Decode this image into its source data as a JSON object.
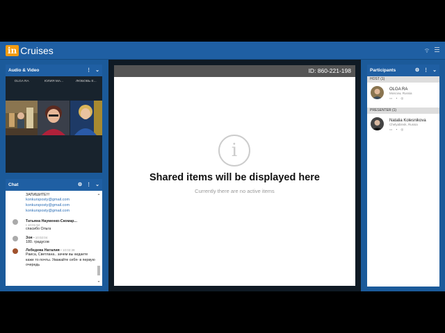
{
  "app": {
    "logo_in": "in",
    "logo_text": "Cruises"
  },
  "av_panel": {
    "title": "Audio & Video",
    "participants": [
      "OLGA RA",
      "ЮЛИЯ МА...",
      "ЛЮБОВЬ Е..."
    ]
  },
  "chat": {
    "title": "Chat",
    "top_text": "ЗАПИШИТЕ!!!",
    "links": [
      "konkursposty@gmail.com",
      "konkursposty@gmail.com",
      "konkursposty@gmail.com"
    ],
    "messages": [
      {
        "name": "Татьяна Науменко-Скомар...",
        "time": "• 10:01:52",
        "text": "спасибо Ольга"
      },
      {
        "name": "Зоя",
        "time": "• 10:02:04",
        "text": "180. градусов"
      },
      {
        "name": "Лебедева Наталия",
        "time": "• 10:02:38",
        "text": "Раиса, Светлана.. зачем вы кидаете каже то почты. Уважайте себя- в первую очередь"
      }
    ]
  },
  "center": {
    "meeting_id": "ID: 860-221-198",
    "title": "Shared items will be displayed here",
    "subtitle": "Currently there are no active items"
  },
  "participants": {
    "title": "Participants",
    "host_label": "HOST (1)",
    "presenter_label": "PRESENTER (1)",
    "host": {
      "name": "OLGA RA",
      "location": "Moscow, Russia"
    },
    "presenter": {
      "name": "Natalia Kolesnikova",
      "location": "Chelyabinsk, Russia"
    }
  }
}
